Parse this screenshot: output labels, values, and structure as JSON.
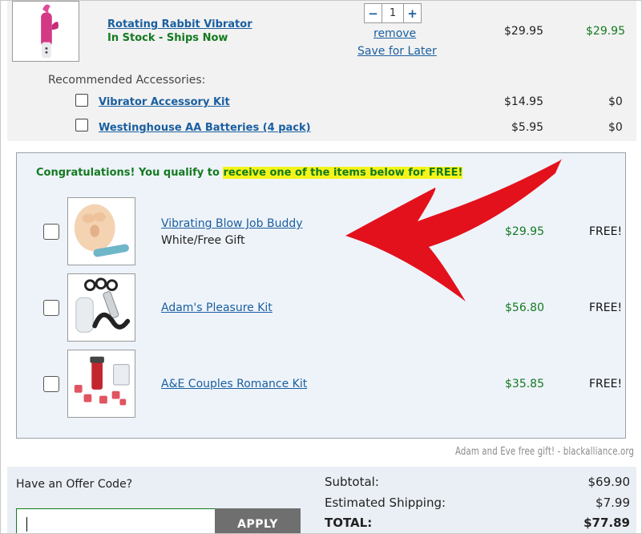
{
  "cart_item": {
    "name": "Rotating Rabbit Vibrator",
    "stock": "In Stock - Ships Now",
    "quantity": "1",
    "qty_minus": "−",
    "qty_plus": "+",
    "remove_label": "remove",
    "save_label": "Save for Later",
    "unit_price": "$29.95",
    "line_total": "$29.95"
  },
  "accessories": {
    "title": "Recommended Accessories:",
    "items": [
      {
        "name": "Vibrator Accessory Kit",
        "price": "$14.95",
        "total": "$0"
      },
      {
        "name": "Westinghouse AA Batteries (4 pack)",
        "price": "$5.95",
        "total": "$0"
      }
    ]
  },
  "free_gifts": {
    "congrats_prefix": "Congratulations! You qualify to ",
    "congrats_highlight": "receive one of the items below for FREE!",
    "items": [
      {
        "name": "Vibrating Blow Job Buddy",
        "subtitle": "White/Free Gift",
        "price": "$29.95",
        "free": "FREE!"
      },
      {
        "name": "Adam's Pleasure Kit",
        "subtitle": "",
        "price": "$56.80",
        "free": "FREE!"
      },
      {
        "name": "A&E Couples Romance Kit",
        "subtitle": "",
        "price": "$35.85",
        "free": "FREE!"
      }
    ]
  },
  "watermark": "Adam and Eve free gift! - blackalliance.org",
  "offer": {
    "label": "Have an Offer Code?",
    "input_value": "",
    "apply_label": "APPLY"
  },
  "summary": {
    "subtotal_label": "Subtotal:",
    "subtotal": "$69.90",
    "shipping_label": "Estimated Shipping:",
    "shipping": "$7.99",
    "total_label": "TOTAL:",
    "total": "$77.89"
  },
  "colors": {
    "link": "#1a5fa0",
    "green": "#137a1f",
    "highlight": "#f4f41a",
    "arrow": "#e3111b"
  },
  "icons": [
    "product-image",
    "checkbox",
    "red-arrow"
  ]
}
